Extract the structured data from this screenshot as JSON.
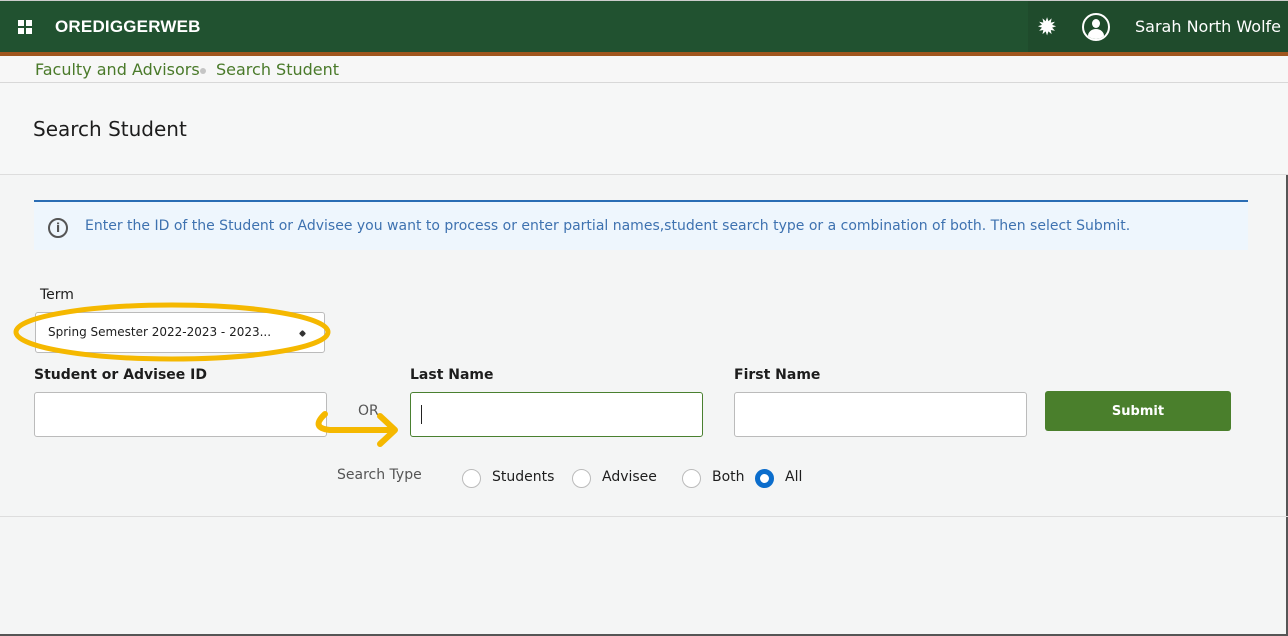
{
  "topbar": {
    "app_title": "OREDIGGERWEB",
    "user_name": "Sarah North Wolfe",
    "icons": [
      "apps-grid-icon",
      "gear-icon",
      "user-avatar-icon"
    ]
  },
  "breadcrumb": {
    "items": [
      "Faculty and Advisors",
      "Search Student"
    ]
  },
  "page": {
    "title": "Search Student"
  },
  "info": {
    "icon": "info-icon",
    "icon_glyph": "i",
    "message": "Enter the ID of the Student or Advisee you want to process or enter partial names,student search type or a combination of both. Then select Submit."
  },
  "form": {
    "term_label": "Term",
    "term_value": "Spring Semester 2022-2023 - 2023...",
    "id_label": "Student or Advisee ID",
    "id_value": "",
    "or_text": "OR",
    "last_name_label": "Last Name",
    "last_name_value": "",
    "first_name_label": "First Name",
    "first_name_value": "",
    "submit_label": "Submit",
    "search_type_label": "Search Type",
    "search_types": [
      {
        "label": "Students",
        "checked": false
      },
      {
        "label": "Advisee",
        "checked": false
      },
      {
        "label": "Both",
        "checked": false
      },
      {
        "label": "All",
        "checked": true
      }
    ]
  },
  "colors": {
    "topbar": "#215230",
    "accent_stripe": "#a0561e",
    "link_green": "#4a7a2a",
    "submit_green": "#4a7f2c",
    "info_blue": "#3e72b0",
    "radio_selected": "#0b6dcc",
    "annotation": "#f5b800"
  }
}
